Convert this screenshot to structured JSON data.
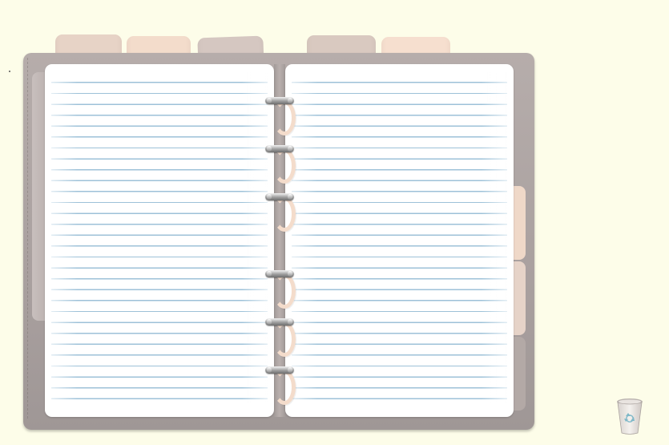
{
  "app": {
    "background_color": "#fdfde9",
    "binder_color": "#aba3a2",
    "page_line_color": "#8cb7d2"
  },
  "binder": {
    "top_tabs": [
      {
        "name": "tab-1",
        "color": "#e7d3c6"
      },
      {
        "name": "tab-2",
        "color": "#f3dccb"
      },
      {
        "name": "tab-3",
        "color": "#d5c7c1"
      },
      {
        "name": "tab-4",
        "color": "#d9c9c0"
      },
      {
        "name": "tab-5",
        "color": "#f6dfcf"
      }
    ],
    "side_tabs": [
      {
        "name": "side-tab-1",
        "color": "#efd8c8"
      },
      {
        "name": "side-tab-2",
        "color": "#e6d3c8"
      },
      {
        "name": "side-tab-3",
        "color": "#b3a9a6"
      }
    ],
    "rings": 6,
    "pages": [
      "left-page",
      "right-page"
    ]
  },
  "icons": {
    "trash": "recycle-bin-icon"
  }
}
